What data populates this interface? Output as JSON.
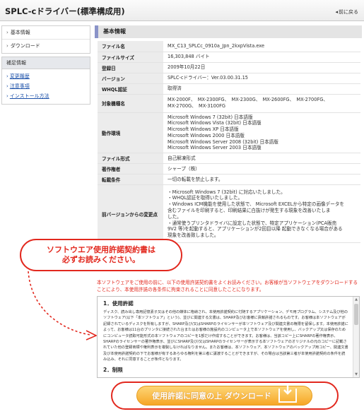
{
  "header": {
    "title": "SPLC-cドライバー(標準構成用)",
    "back_label": "前に戻る"
  },
  "sidebar": {
    "top_items": [
      {
        "label": "基本情報"
      },
      {
        "label": "ダウンロード"
      }
    ],
    "group_title": "補足情報",
    "group_items": [
      {
        "label": "変更履歴"
      },
      {
        "label": "注意事項"
      },
      {
        "label": "インストール方法"
      }
    ]
  },
  "main": {
    "section_title": "基本情報",
    "rows": [
      {
        "key": "ファイル名",
        "lines": [
          "MX_C13_SPLCc_0910a_Jpn_2kxpVista.exe"
        ]
      },
      {
        "key": "ファイルサイズ",
        "lines": [
          "16,303,848 バイト"
        ]
      },
      {
        "key": "登録日",
        "lines": [
          "2009年10月22日"
        ]
      },
      {
        "key": "バージョン",
        "lines": [
          "SPLC-cドライバー：Ver.03.00.31.15"
        ]
      },
      {
        "key": "WHQL認証",
        "lines": [
          "取得済"
        ]
      },
      {
        "key": "対象機種名",
        "lines": [
          "MX-2000F、　MX-2300FG、　MX-2300G、　MX-2600FG、　MX-2700FG、",
          "MX-2700G、　MX-3100FG"
        ]
      },
      {
        "key": "動作環境",
        "lines": [
          "Microsoft Windows 7 (32bit) 日本語版",
          "Microsoft Windows Vista (32bit) 日本語版",
          "Microsoft Windows XP 日本語版",
          "Microsoft Windows 2000 日本語版",
          "Microsoft Windows Server 2008 (32bit) 日本語版",
          "Microsoft Windows Server 2003 日本語版"
        ]
      },
      {
        "key": "ファイル形式",
        "lines": [
          "自己解凍形式"
        ]
      },
      {
        "key": "著作権者",
        "lines": [
          "シャープ（株）"
        ]
      },
      {
        "key": "転載条件",
        "lines": [
          "一切の転載を禁止します。"
        ]
      },
      {
        "key": "前バージョンからの変更点",
        "lines": [
          "・Microsoft Windows 7 (32bit) に対応いたしました。",
          "・WHQL認証を取得いたしました。",
          "・Windows ICM機能を使用した状態で、 Microsoft EXCELから特定の画像データを",
          "含むファイルを印刷すると、印刷結果に白抜けが発生する現象を改善いたしま",
          "した。",
          "・通常使うプリンタドライバに設定した状態で、特定アプリケーション(PCA販売",
          "9V2 等)を起動すると、アプリケーションが2回目以降 起動できなくなる場合がある",
          "現象を改善致しました。"
        ]
      }
    ]
  },
  "callout": {
    "line1": "ソフトウエア使用許諾契約書は",
    "line2": "必ずお読みください。"
  },
  "notice_text": "本ソフトウェアをご使用の前に、以下の使用許諾契約書をよくお読みください。お客様が当ソフトウェアをダウンロードすることにより、本使用許諾の各条件に拘束されることに同意したことになります。",
  "agreement": {
    "heading1": "1．使用許諾",
    "body": "ディスク、読み出し専用記憶素子又はその他の媒体に格納され、本使用許諾契約に付随するアプリケーション、デモ用プログラム、システム及び他のソフトウェア(以下「本ソフトウェア」という)、並びに関連する文書は、SHARP及びお客様に貢献許諾されるものです。お客様は本ソフトウェアが記録されているディスクを所有しますが、SHARP及び/又はSHARPのライセンサーが本ソフトウェア及び関連文書の権限を留保します。本使用許諾によって、お客様は11台のプリンタに接続された台またはお客様の施設内のコンピュータ上で本ソフトウェアを使用し、バックアップ又は保存のためにコンピュータ読取可能形式の本ソフトウェアのコピーを1部だけ作成することができます。お客様は、当該コピー上にSHARPの著作権表示、SHARPのライセンサーの著作権表示、並びにSHARP及び/又はSHARPのライセンサーが表示する本ソフトウェアのオリジナルの元のコピーに記載されていた他の登録商標や権利表示を複製しなければなりません。またお客様は、本ソフトウェア、本ソフトウェアのバックアップ用コピー、関連文書及び本使用許諾契約の下でお客様が有するあらゆる権利を第三者に譲渡することができますが、その場合は当該第三者が本使用許諾契約の条件を読み込み、それに同意することが条件となります。",
    "heading2": "2．制限"
  },
  "download_button": {
    "label": "使用許諾に同意の上 ダウンロード"
  },
  "colors": {
    "accent_red": "#e2281e",
    "button_orange": "#f6a626",
    "section_bar": "#8a93c8"
  }
}
